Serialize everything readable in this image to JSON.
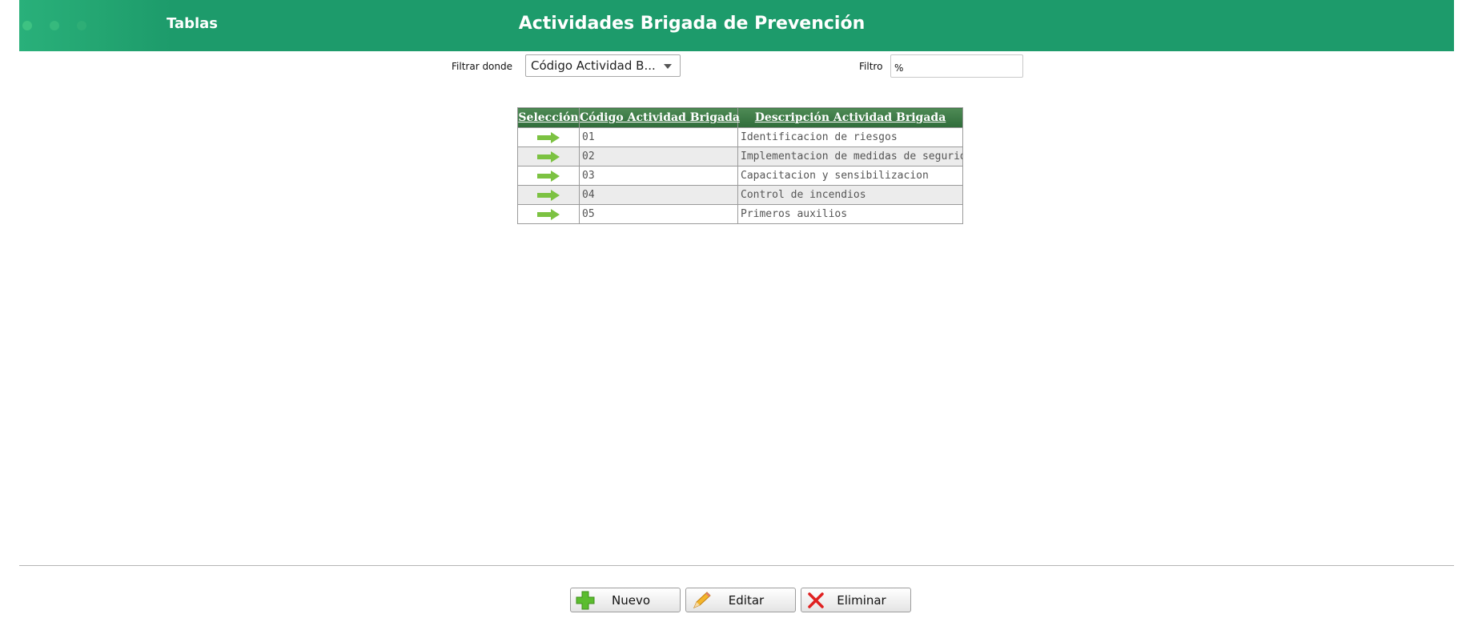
{
  "header": {
    "nav_label": "Tablas",
    "title": "Actividades Brigada de Prevención"
  },
  "filter": {
    "field_label": "Filtrar donde",
    "field_selected": "Código Actividad B...",
    "value_label": "Filtro",
    "value": "%"
  },
  "table": {
    "columns": [
      "Selección",
      "Código Actividad Brigada",
      "Descripción Actividad Brigada"
    ],
    "rows": [
      {
        "code": "01",
        "description": "Identificacion de riesgos"
      },
      {
        "code": "02",
        "description": "Implementacion de medidas de seguridad"
      },
      {
        "code": "03",
        "description": "Capacitacion y sensibilizacion"
      },
      {
        "code": "04",
        "description": "Control de incendios"
      },
      {
        "code": "05",
        "description": "Primeros auxilios"
      }
    ]
  },
  "actions": {
    "new_label": "Nuevo",
    "edit_label": "Editar",
    "delete_label": "Eliminar"
  },
  "colors": {
    "header_bg": "#1d9b6b",
    "table_header_bg": "#3a7a44",
    "select_arrow": "#7cc242",
    "delete_red": "#e02020"
  },
  "icons": {
    "row_select": "arrow-right-icon",
    "new": "plus-icon",
    "edit": "pencil-icon",
    "delete": "x-icon"
  }
}
